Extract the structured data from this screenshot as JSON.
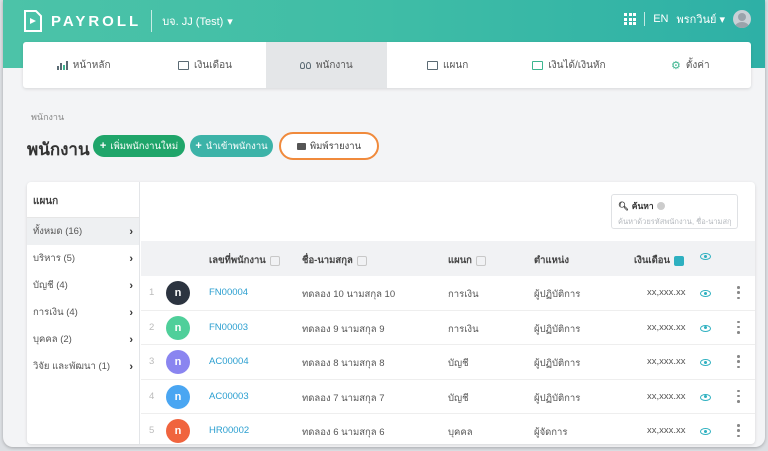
{
  "app": {
    "name": "PAYROLL",
    "company": "บจ. JJ (Test)"
  },
  "topbar": {
    "lang": "EN",
    "user": "พรกวินย์"
  },
  "nav": [
    {
      "label": "หน้าหลัก",
      "icon": "chart-icon"
    },
    {
      "label": "เงินเดือน",
      "icon": "salary-icon"
    },
    {
      "label": "พนักงาน",
      "icon": "people-icon"
    },
    {
      "label": "แผนก",
      "icon": "department-icon"
    },
    {
      "label": "เงินได้/เงินหัก",
      "icon": "income-deduct-icon"
    },
    {
      "label": "ตั้งค่า",
      "icon": "gear-icon"
    }
  ],
  "breadcrumb": "พนักงาน",
  "page_title": "พนักงาน",
  "buttons": {
    "add": "เพิ่มพนักงานใหม่",
    "import": "นำเข้าพนักงาน",
    "print": "พิมพ์รายงาน"
  },
  "sidebar": {
    "title": "แผนก",
    "items": [
      {
        "label": "ทั้งหมด (16)"
      },
      {
        "label": "บริหาร (5)"
      },
      {
        "label": "บัญชี (4)"
      },
      {
        "label": "การเงิน (4)"
      },
      {
        "label": "บุคคล (2)"
      },
      {
        "label": "วิจัย และพัฒนา (1)"
      }
    ]
  },
  "search": {
    "label": "ค้นหา",
    "placeholder": "ค้นหาด้วยรหัสพนักงาน, ชื่อ-นามสกุล"
  },
  "table": {
    "headers": {
      "code": "เลขที่พนักงาน",
      "name": "ชื่อ-นามสกุล",
      "dept": "แผนก",
      "position": "ตำแหน่ง",
      "salary": "เงินเดือน"
    },
    "rows": [
      {
        "num": "1",
        "initial": "n",
        "color": "#2c3440",
        "code": "FN00004",
        "name": "ทดลอง 10 นามสกุล 10",
        "dept": "การเงิน",
        "position": "ผู้ปฏิบัติการ",
        "salary": "xx,xxx.xx"
      },
      {
        "num": "2",
        "initial": "n",
        "color": "#4fcf9a",
        "code": "FN00003",
        "name": "ทดลอง 9 นามสกุล 9",
        "dept": "การเงิน",
        "position": "ผู้ปฏิบัติการ",
        "salary": "xx,xxx.xx"
      },
      {
        "num": "3",
        "initial": "n",
        "color": "#8a85f0",
        "code": "AC00004",
        "name": "ทดลอง 8 นามสกุล 8",
        "dept": "บัญชี",
        "position": "ผู้ปฏิบัติการ",
        "salary": "xx,xxx.xx"
      },
      {
        "num": "4",
        "initial": "n",
        "color": "#4aa6f2",
        "code": "AC00003",
        "name": "ทดลอง 7 นามสกุล 7",
        "dept": "บัญชี",
        "position": "ผู้ปฏิบัติการ",
        "salary": "xx,xxx.xx"
      },
      {
        "num": "5",
        "initial": "n",
        "color": "#f0643e",
        "code": "HR00002",
        "name": "ทดลอง 6 นามสกุล 6",
        "dept": "บุคคล",
        "position": "ผู้จัดการ",
        "salary": "xx,xxx.xx"
      }
    ]
  }
}
